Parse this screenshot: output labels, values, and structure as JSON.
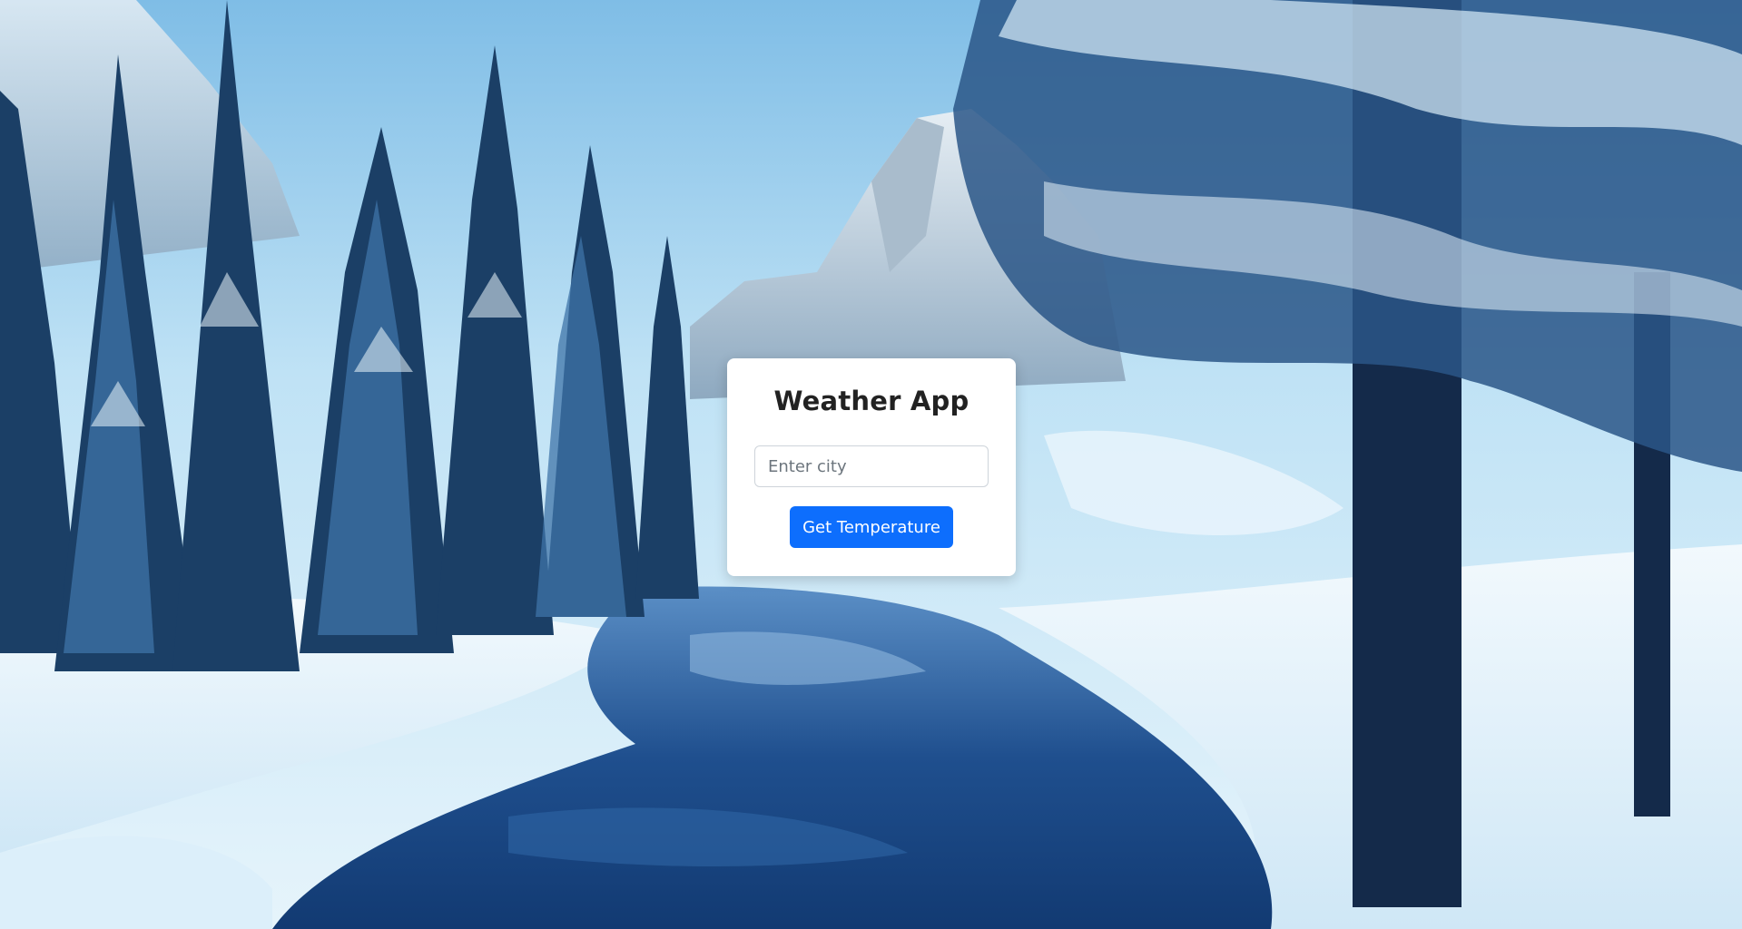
{
  "app": {
    "title": "Weather App"
  },
  "search": {
    "placeholder": "Enter city",
    "value": ""
  },
  "actions": {
    "get_temperature_label": "Get Temperature"
  },
  "colors": {
    "primary": "#0d6efd",
    "card_background": "#ffffff",
    "title_text": "#222222",
    "sky": "#9fd0ee",
    "snow": "#eaf6fd",
    "water": "#1d4d8c"
  },
  "background": {
    "scene": "snowy-forest-river"
  }
}
